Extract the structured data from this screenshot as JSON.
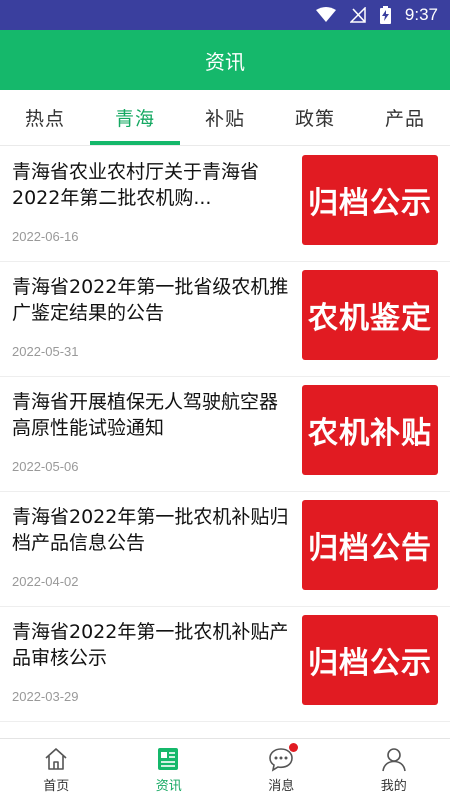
{
  "status_bar": {
    "time": "9:37",
    "icons": [
      "wifi-icon",
      "signal-off-icon",
      "battery-charging-icon"
    ]
  },
  "header": {
    "title": "资讯"
  },
  "tabs": [
    {
      "label": "热点",
      "active": false
    },
    {
      "label": "青海",
      "active": true
    },
    {
      "label": "补贴",
      "active": false
    },
    {
      "label": "政策",
      "active": false
    },
    {
      "label": "产品",
      "active": false
    }
  ],
  "news": [
    {
      "title": "青海省农业农村厅关于青海省2022年第二批农机购...",
      "date": "2022-06-16",
      "thumb_text": "归档公示"
    },
    {
      "title": "青海省2022年第一批省级农机推广鉴定结果的公告",
      "date": "2022-05-31",
      "thumb_text": "农机鉴定"
    },
    {
      "title": "青海省开展植保无人驾驶航空器高原性能试验通知",
      "date": "2022-05-06",
      "thumb_text": "农机补贴"
    },
    {
      "title": "青海省2022年第一批农机补贴归档产品信息公告",
      "date": "2022-04-02",
      "thumb_text": "归档公告"
    },
    {
      "title": "青海省2022年第一批农机补贴产品审核公示",
      "date": "2022-03-29",
      "thumb_text": "归档公示"
    }
  ],
  "bottom_nav": [
    {
      "label": "首页",
      "icon": "home-icon",
      "active": false
    },
    {
      "label": "资讯",
      "icon": "news-icon",
      "active": true
    },
    {
      "label": "消息",
      "icon": "message-icon",
      "active": false,
      "badge": true
    },
    {
      "label": "我的",
      "icon": "profile-icon",
      "active": false
    }
  ],
  "colors": {
    "status_bar": "#3a3f9e",
    "header": "#15b86b",
    "accent": "#15a862",
    "thumb_red": "#e11b22"
  }
}
